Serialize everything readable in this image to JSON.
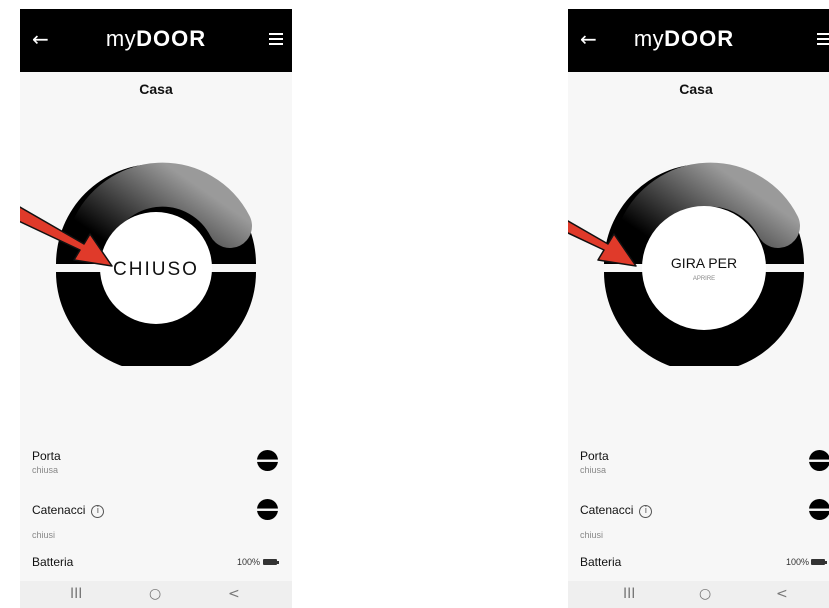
{
  "top_strip_text": "",
  "left_screen": {
    "brand_prefix": "my",
    "brand_main": "DOOR",
    "page_title": "Casa",
    "dial_text": "CHIUSO",
    "dial_subtext": "",
    "porta": {
      "label": "Porta",
      "value": "chiusa"
    },
    "catenacci": {
      "label": "Catenacci",
      "value": "chiusi",
      "info_symbol": "i"
    },
    "batteria": {
      "label": "Batteria",
      "value": "100%"
    },
    "nav": {
      "recents": "III",
      "home": "○",
      "back": "<"
    }
  },
  "right_screen": {
    "brand_prefix": "my",
    "brand_main": "DOOR",
    "page_title": "Casa",
    "dial_text": "GIRA PER",
    "dial_subtext": "APRIRE",
    "porta": {
      "label": "Porta",
      "value": "chiusa"
    },
    "catenacci": {
      "label": "Catenacci",
      "value": "chiusi",
      "info_symbol": "i"
    },
    "batteria": {
      "label": "Batteria",
      "value": "100%"
    },
    "nav": {
      "recents": "III",
      "home": "○",
      "back": "<"
    }
  },
  "icons": {
    "back": "back-arrow-icon",
    "menu": "hamburger-menu-icon",
    "info": "info-icon",
    "state": "half-filled-disc-icon",
    "battery": "battery-icon",
    "annotation": "red-arrow"
  },
  "colors": {
    "app_bar": "#000000",
    "screen_background": "#f7f7f7",
    "dial_ring": "#000000",
    "dial_gradient_light": "#9a9a9a",
    "annotation_arrow": "#e03a2a",
    "nav_bar": "#efefef"
  }
}
